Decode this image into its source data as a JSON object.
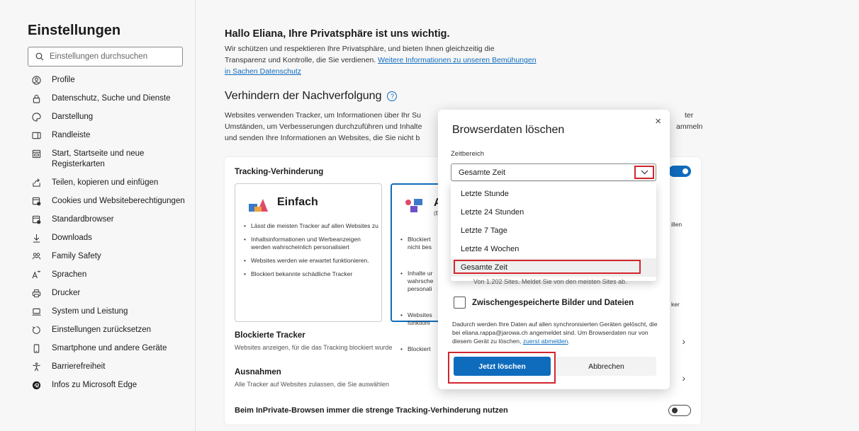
{
  "sidebar": {
    "title": "Einstellungen",
    "search_placeholder": "Einstellungen durchsuchen",
    "items": [
      {
        "label": "Profile"
      },
      {
        "label": "Datenschutz, Suche und Dienste"
      },
      {
        "label": "Darstellung"
      },
      {
        "label": "Randleiste"
      },
      {
        "label": "Start, Startseite und neue Registerkarten"
      },
      {
        "label": "Teilen, kopieren und einfügen"
      },
      {
        "label": "Cookies und Websiteberechtigungen"
      },
      {
        "label": "Standardbrowser"
      },
      {
        "label": "Downloads"
      },
      {
        "label": "Family Safety"
      },
      {
        "label": "Sprachen"
      },
      {
        "label": "Drucker"
      },
      {
        "label": "System und Leistung"
      },
      {
        "label": "Einstellungen zurücksetzen"
      },
      {
        "label": "Smartphone und andere Geräte"
      },
      {
        "label": "Barrierefreiheit"
      },
      {
        "label": "Infos zu Microsoft Edge"
      }
    ]
  },
  "main": {
    "hello_title": "Hallo Eliana, Ihre Privatsphäre ist uns wichtig.",
    "hello_text": "Wir schützen und respektieren Ihre Privatsphäre, und bieten Ihnen gleichzeitig die Transparenz und Kontrolle, die Sie verdienen.",
    "hello_link": "Weitere Informationen zu unseren Bemühungen in Sachen Datenschutz",
    "section_title": "Verhindern der Nachverfolgung",
    "section_desc_1": "Websites verwenden Tracker, um Informationen über Ihr Su",
    "section_desc_2": "Umständen, um Verbesserungen durchzuführen und Inhalte",
    "section_desc_3": "und senden Ihre Informationen an Websites, die Sie nicht b",
    "section_desc_r1": "ter",
    "section_desc_r2": "ammeln",
    "card_header": "Tracking-Verhinderung",
    "basic": {
      "title": "Einfach",
      "bullets": [
        "Lässt die meisten Tracker auf allen Websites zu",
        "Inhaltsinformationen und Werbeanzeigen werden wahrscheinlich personalisiert",
        "Websites werden wie erwartet funktionieren.",
        "Blockiert bekannte schädliche Tracker"
      ]
    },
    "balanced": {
      "title": "A",
      "sub": "(E",
      "bullets": [
        "Blockiert\nnicht bes",
        "Inhalte ur\nwahrsche\npersonali",
        "Websites\nfunktioni",
        "Blockiert"
      ]
    },
    "strict_partial_1": "illen",
    "strict_partial_2": "ker",
    "blocked_title": "Blockierte Tracker",
    "blocked_sub": "Websites anzeigen, für die das Tracking blockiert wurde",
    "exceptions_title": "Ausnahmen",
    "exceptions_sub": "Alle Tracker auf Websites zulassen, die Sie auswählen",
    "inprivate_label": "Beim InPrivate-Browsen immer die strenge Tracking-Verhinderung nutzen"
  },
  "dialog": {
    "title": "Browserdaten löschen",
    "close": "×",
    "zeit_label": "Zeitbereich",
    "selected": "Gesamte Zeit",
    "options": [
      "Letzte Stunde",
      "Letzte 24 Stunden",
      "Letzte 7 Tage",
      "Letzte 4 Wochen",
      "Gesamte Zeit"
    ],
    "cookie_sub": "Von 1.202 Sites. Meldet Sie von den meisten Sites ab.",
    "checkbox_label": "Zwischengespeicherte Bilder und Dateien",
    "note": "Dadurch werden Ihre Daten auf allen synchronisierten Geräten gelöscht, die bei eliana.rappa@jarowa.ch angemeldet sind. Um Browserdaten nur von diesem Gerät zu löschen,",
    "note_link": "zuerst abmelden",
    "btn_clear": "Jetzt löschen",
    "btn_cancel": "Abbrechen"
  },
  "colors": {
    "accent": "#0f6cbd",
    "highlight": "#d1262d"
  }
}
